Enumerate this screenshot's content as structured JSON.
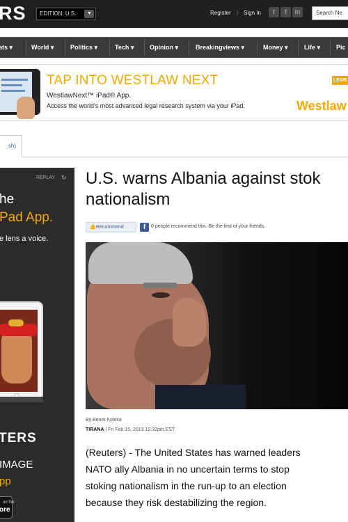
{
  "header": {
    "logo": "RS",
    "edition": "EDITION: U.S.",
    "register": "Register",
    "divider": "|",
    "signin": "Sign In",
    "search_placeholder": "Search Ne"
  },
  "nav": {
    "items": [
      "ats ▾",
      "World ▾",
      "Politics ▾",
      "Tech ▾",
      "Opinion ▾",
      "Breakingviews ▾",
      "Money ▾",
      "Life ▾",
      "Pic"
    ]
  },
  "banner": {
    "headline": "TAP INTO WESTLAW NEXT",
    "line1": "WestlawNext™ iPad® App.",
    "line2": "Access the world's most advanced legal research system via your iPad.",
    "brand": "Westlaw",
    "learn": "LEAR"
  },
  "subtab": {
    "label": "sh)"
  },
  "left_ad": {
    "replay": "REPLAY",
    "line1": "he",
    "line2": "Pad App.",
    "line3": "e lens a voice.",
    "brand": "TERS",
    "image_label": "IMAGE",
    "app_label": "pp",
    "button_small": "on the",
    "button_big": "ore"
  },
  "article": {
    "headline_line1": "U.S. warns Albania against stok",
    "headline_line2": "nationalism",
    "recommend_label": "Recommend",
    "recommend_text": "0 people recommend this. Be the first of your friends.",
    "byline": "By Benet Koleka",
    "dateline_city": "TIRANA",
    "dateline_time": " | Fri Feb 15, 2013 12:32pm EST",
    "body": [
      "(Reuters) - The United States has warned leaders",
      "NATO ally Albania in no uncertain terms to stop",
      "stoking nationalism in the run-up to an election",
      "because they risk destabilizing the region."
    ]
  },
  "colors": {
    "accent_orange": "#f2a900",
    "topbar": "#1f1f1f",
    "navbar": "#3a3a3a",
    "facebook": "#3b5998"
  }
}
